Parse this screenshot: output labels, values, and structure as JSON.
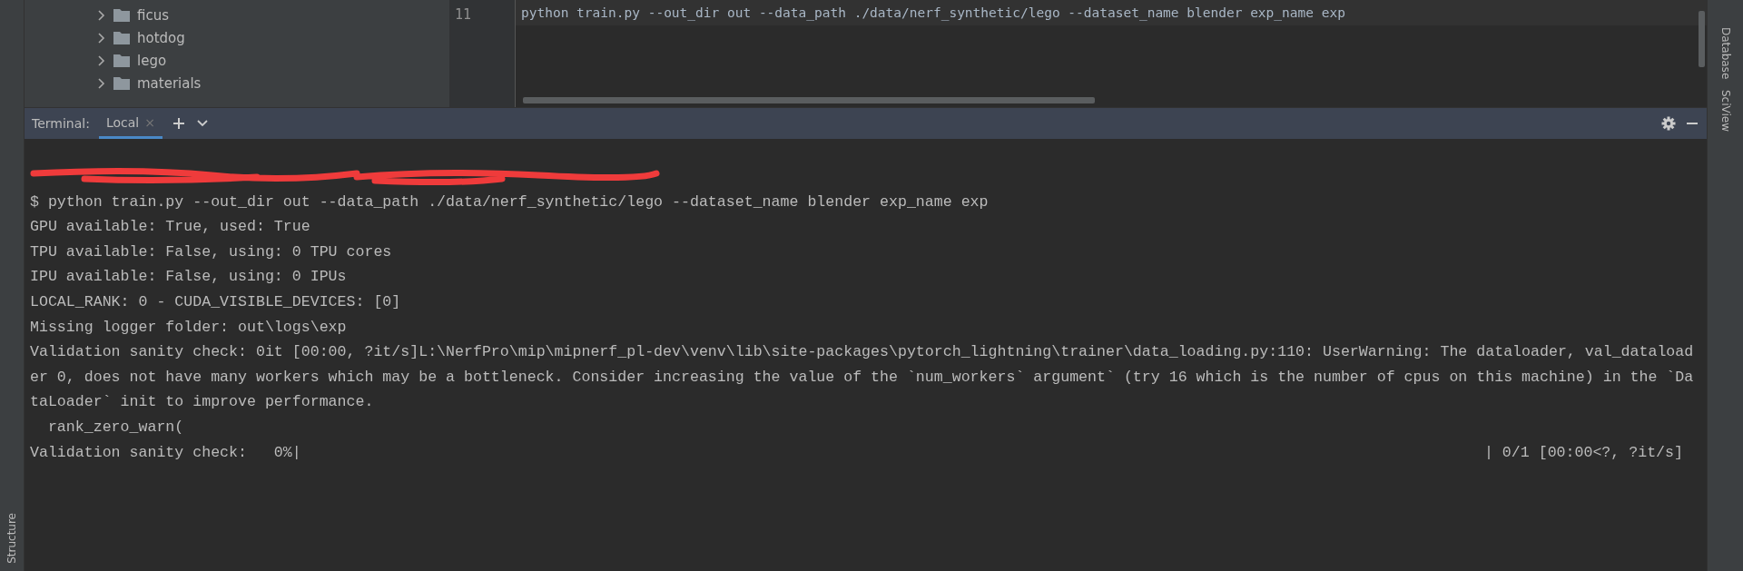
{
  "project_tree": {
    "items": [
      {
        "name": "ficus",
        "expanded": false
      },
      {
        "name": "hotdog",
        "expanded": false
      },
      {
        "name": "lego",
        "expanded": false
      },
      {
        "name": "materials",
        "expanded": false
      }
    ]
  },
  "editor": {
    "lines": [
      {
        "number": "11",
        "code": "python train.py --out_dir out --data_path ./data/nerf_synthetic/lego --dataset_name blender exp_name exp"
      }
    ]
  },
  "terminal": {
    "label": "Terminal:",
    "tabs": [
      {
        "label": "Local",
        "close": "×",
        "selected": true
      }
    ],
    "lines": [
      {
        "kind": "redacted"
      },
      {
        "kind": "text",
        "text": "$ python train.py --out_dir out --data_path ./data/nerf_synthetic/lego --dataset_name blender exp_name exp"
      },
      {
        "kind": "text",
        "text": "GPU available: True, used: True"
      },
      {
        "kind": "text",
        "text": "TPU available: False, using: 0 TPU cores"
      },
      {
        "kind": "text",
        "text": "IPU available: False, using: 0 IPUs"
      },
      {
        "kind": "text",
        "text": "LOCAL_RANK: 0 - CUDA_VISIBLE_DEVICES: [0]"
      },
      {
        "kind": "text",
        "text": "Missing logger folder: out\\logs\\exp"
      },
      {
        "kind": "text",
        "text": "Validation sanity check: 0it [00:00, ?it/s]L:\\NerfPro\\mip\\mipnerf_pl-dev\\venv\\lib\\site-packages\\pytorch_lightning\\trainer\\data_loading.py:110: UserWarning: The dataloader, val_dataload"
      },
      {
        "kind": "text",
        "text": "er 0, does not have many workers which may be a bottleneck. Consider increasing the value of the `num_workers` argument` (try 16 which is the number of cpus on this machine) in the `Da"
      },
      {
        "kind": "text",
        "text": "taLoader` init to improve performance."
      },
      {
        "kind": "text",
        "text": "  rank_zero_warn("
      },
      {
        "kind": "progress",
        "left": "Validation sanity check:   0%|",
        "right": "| 0/1 [00:00<?, ?it/s]"
      }
    ]
  },
  "right_stripe": [
    "Database",
    "SciView"
  ],
  "left_stripe": [
    "Structure"
  ]
}
